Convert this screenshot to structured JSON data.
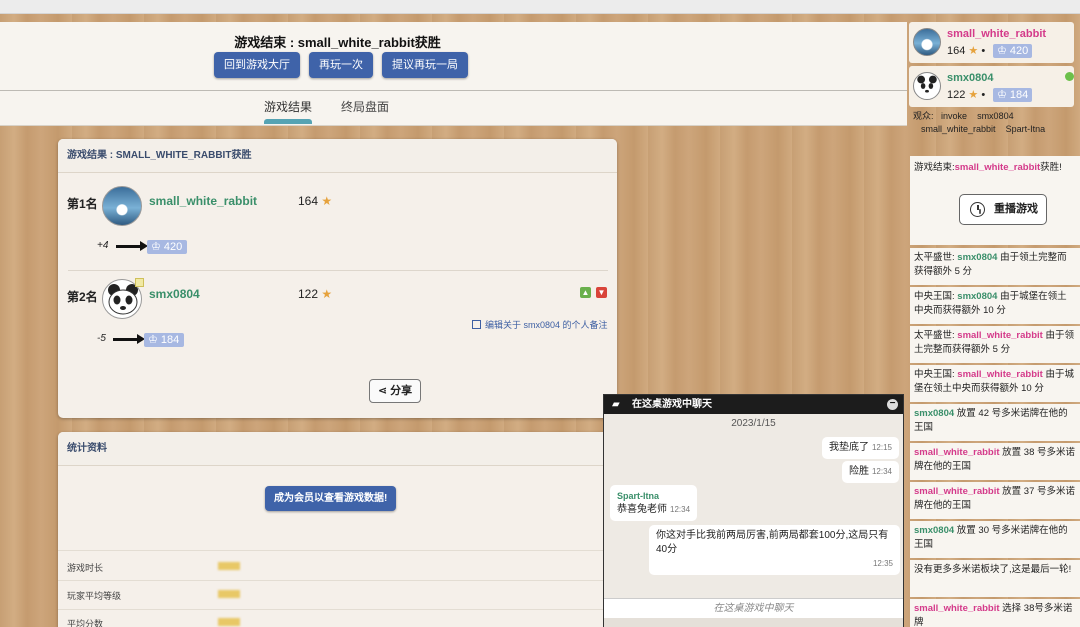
{
  "header": {
    "title": "游戏结束 : small_white_rabbit获胜",
    "buttons": [
      "回到游戏大厅",
      "再玩一次",
      "提议再玩一局"
    ],
    "tabs": [
      "游戏结果",
      "终局盘面"
    ]
  },
  "results": {
    "panel_title": "游戏结果 : SMALL_WHITE_RABBIT获胜",
    "players": [
      {
        "rank": "第1名",
        "name": "small_white_rabbit",
        "score": "164",
        "delta": "+4",
        "elo": "420"
      },
      {
        "rank": "第2名",
        "name": "smx0804",
        "score": "122",
        "delta": "-5",
        "elo": "184",
        "note": "编辑关于 smx0804 的个人备注"
      }
    ],
    "share": "分享"
  },
  "stats": {
    "panel_title": "统计资料",
    "member_button": "成为会员以查看游戏数据!",
    "rows": [
      "游戏时长",
      "玩家平均等级",
      "平均分数"
    ]
  },
  "sidebar": {
    "players": [
      {
        "name": "small_white_rabbit",
        "score": "164",
        "elo": "420"
      },
      {
        "name": "smx0804",
        "score": "122",
        "elo": "184"
      }
    ],
    "observers_label": "观众:",
    "observers_line1": [
      "invoke",
      "smx0804"
    ],
    "observers_line2": [
      "small_white_rabbit",
      "Spart-Itna"
    ],
    "end_msg_prefix": "游戏结束:",
    "end_msg_name": "small_white_rabbit",
    "end_msg_suffix": "获胜!",
    "replay": "重播游戏",
    "log": [
      {
        "pre": "太平盛世: ",
        "name": "smx0804",
        "color": "green",
        "text": " 由于领土完整而获得额外 5 分"
      },
      {
        "pre": "中央王国: ",
        "name": "smx0804",
        "color": "green",
        "text": " 由于城堡在领土中央而获得额外 10 分"
      },
      {
        "pre": "太平盛世: ",
        "name": "small_white_rabbit",
        "color": "pink",
        "text": " 由于领土完整而获得额外 5 分"
      },
      {
        "pre": "中央王国: ",
        "name": "small_white_rabbit",
        "color": "pink",
        "text": " 由于城堡在领土中央而获得额外 10 分"
      },
      {
        "pre": "",
        "name": "smx0804",
        "color": "green",
        "text": " 放置 42 号多米诺牌在他的王国"
      },
      {
        "pre": "",
        "name": "small_white_rabbit",
        "color": "pink",
        "text": " 放置 38 号多米诺牌在他的王国"
      },
      {
        "pre": "",
        "name": "small_white_rabbit",
        "color": "pink",
        "text": " 放置 37 号多米诺牌在他的王国"
      },
      {
        "pre": "",
        "name": "smx0804",
        "color": "green",
        "text": " 放置 30 号多米诺牌在他的王国"
      },
      {
        "pre": "没有更多多米诺板块了,这是最后一轮!",
        "name": "",
        "color": "",
        "text": ""
      },
      {
        "pre": "",
        "name": "small_white_rabbit",
        "color": "pink",
        "text": " 选择 38号多米诺牌"
      }
    ]
  },
  "chat": {
    "title": "在这桌游戏中聊天",
    "date": "2023/1/15",
    "messages": [
      {
        "text": "我垫底了",
        "time": "12:15",
        "side": "right"
      },
      {
        "text": "险胜",
        "time": "12:34",
        "side": "right"
      },
      {
        "author": "Spart-Itna",
        "text": "恭喜兔老师",
        "time": "12:34",
        "side": "left"
      },
      {
        "text": "你这对手比我前两局厉害,前两局都套100分,这局只有40分",
        "time": "12:35",
        "side": "right"
      }
    ],
    "placeholder": "在这桌游戏中聊天"
  },
  "colors": {
    "accent": "#3f63a9",
    "green_name": "#3a8f6a",
    "pink_name": "#d43a8a",
    "elo_badge": "#a7b8e2",
    "tab_underline": "#55a3b3"
  }
}
